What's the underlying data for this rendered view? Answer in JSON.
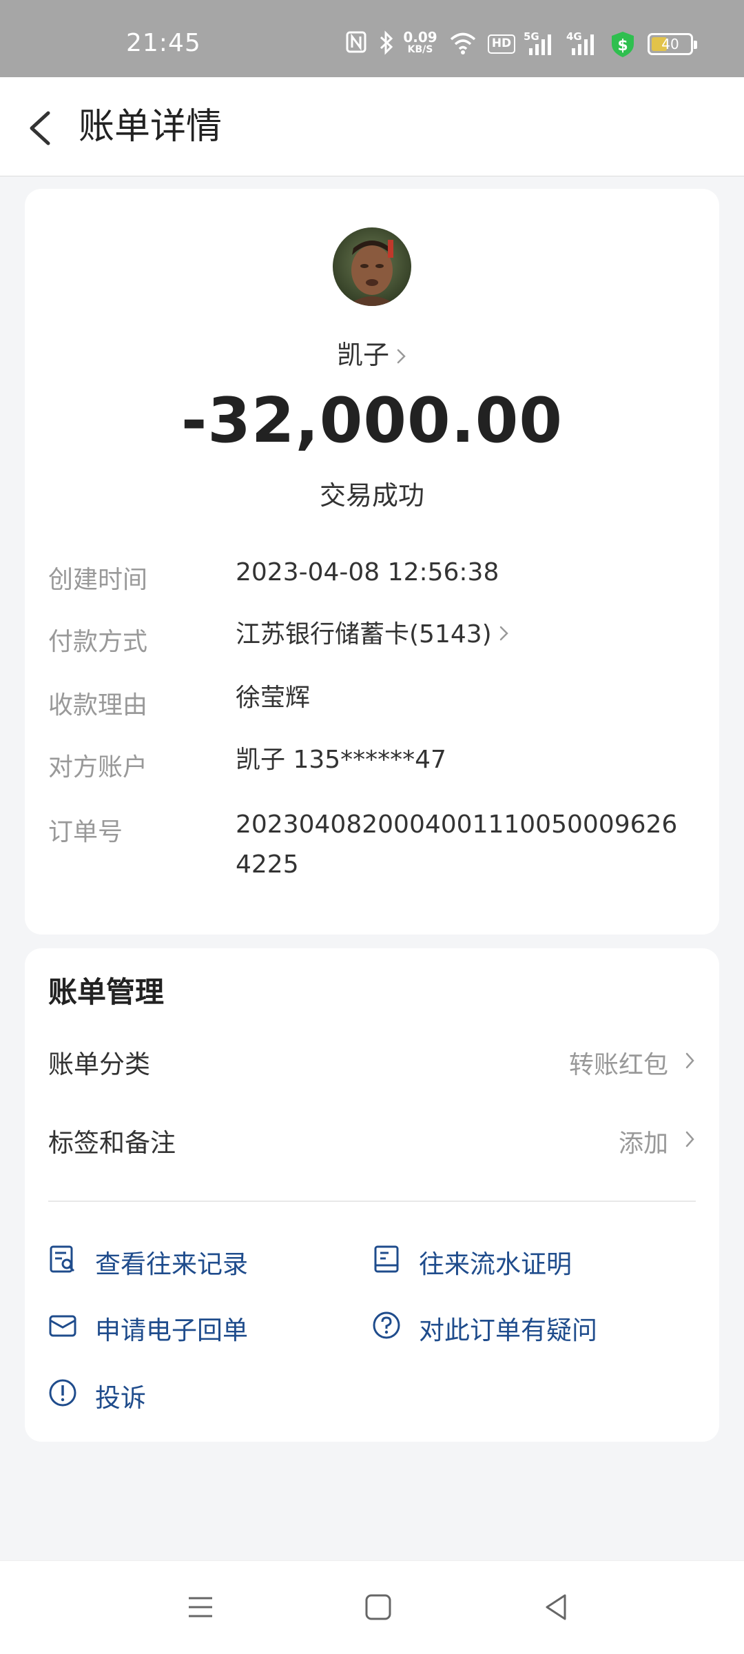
{
  "status_bar": {
    "time": "21:45",
    "net_speed_value": "0.09",
    "net_speed_unit": "KB/S",
    "hd_label": "HD",
    "sig1_label": "5G",
    "sig2_label": "4G",
    "battery": "40"
  },
  "header": {
    "title": "账单详情"
  },
  "payee": {
    "name": "凯子",
    "amount": "-32,000.00",
    "status": "交易成功"
  },
  "details": [
    {
      "label": "创建时间",
      "value": "2023-04-08 12:56:38"
    },
    {
      "label": "付款方式",
      "value": "江苏银行储蓄卡(5143)"
    },
    {
      "label": "收款理由",
      "value": "徐莹辉"
    },
    {
      "label": "对方账户",
      "value": "凯子 135******47"
    },
    {
      "label": "订单号",
      "value": "20230408200040011100500096264225"
    }
  ],
  "management": {
    "title": "账单管理",
    "category_label": "账单分类",
    "category_value": "转账红包",
    "tags_label": "标签和备注",
    "tags_value": "添加"
  },
  "actions": {
    "history": "查看往来记录",
    "statement": "往来流水证明",
    "receipt": "申请电子回单",
    "question": "对此订单有疑问",
    "complaint": "投诉"
  },
  "colors": {
    "accent": "#1f4c8c",
    "status_bar": "#a6a6a6",
    "background": "#f4f5f7"
  }
}
